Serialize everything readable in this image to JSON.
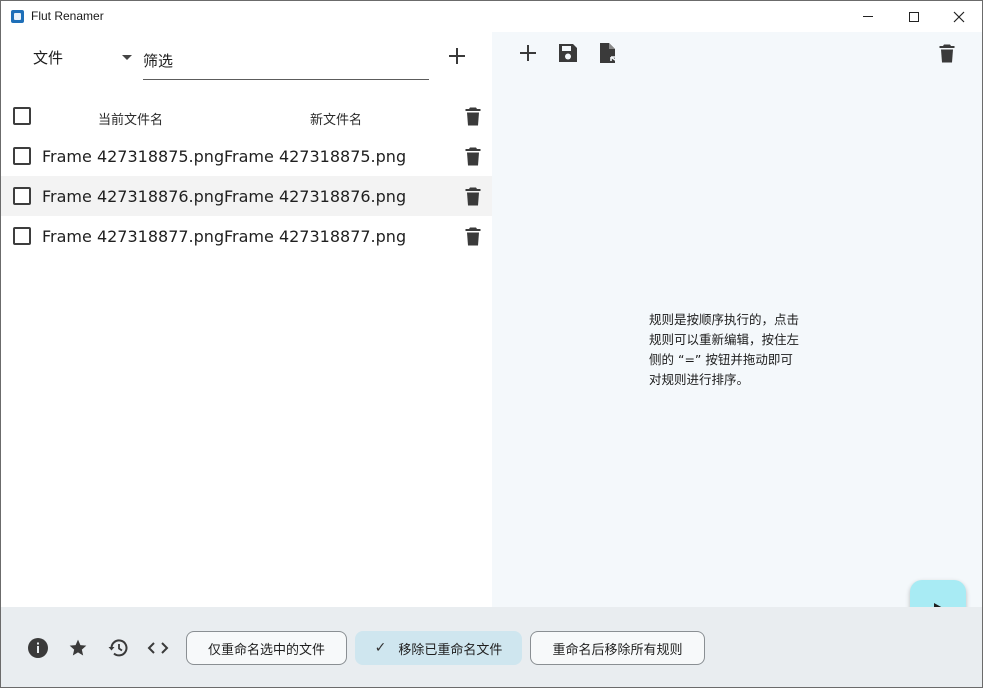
{
  "window": {
    "title": "Flut Renamer",
    "minimize_icon": "minimize-icon",
    "maximize_icon": "maximize-icon",
    "close_icon": "close-icon"
  },
  "file_panel": {
    "type_dropdown": {
      "selected": "文件"
    },
    "filter": {
      "placeholder": "筛选",
      "value": ""
    },
    "add_icon": "plus-icon",
    "columns": {
      "current_name": "当前文件名",
      "new_name": "新文件名"
    },
    "rows": [
      {
        "current": "Frame 427318875.png",
        "new": "Frame 427318875.png",
        "checked": false
      },
      {
        "current": "Frame 427318876.png",
        "new": "Frame 427318876.png",
        "checked": false
      },
      {
        "current": "Frame 427318877.png",
        "new": "Frame 427318877.png",
        "checked": false
      }
    ]
  },
  "rules_panel": {
    "toolbar_icons": [
      "plus-icon",
      "save-icon",
      "file-export-icon",
      "trash-icon"
    ],
    "hint_lines": [
      "规则是按顺序执行的，点击",
      "规则可以重新编辑，按住左",
      "侧的 “=” 按钮并拖动即可",
      "对规则进行排序。"
    ],
    "run_icon": "play-icon"
  },
  "bottom_bar": {
    "icons": [
      "info-icon",
      "star-icon",
      "history-icon",
      "code-icon"
    ],
    "buttons": {
      "rename_selected_only": "仅重命名选中的文件",
      "remove_renamed": "移除已重命名文件",
      "clear_rules_after": "重命名后移除所有规则"
    }
  },
  "colors": {
    "fab_bg": "#a8ebf4",
    "active_chip_bg": "#cfe6ef",
    "rules_panel_bg": "#f4f8fb",
    "bottom_bar_bg": "#e9edf0",
    "app_icon": "#1e6fb8"
  }
}
